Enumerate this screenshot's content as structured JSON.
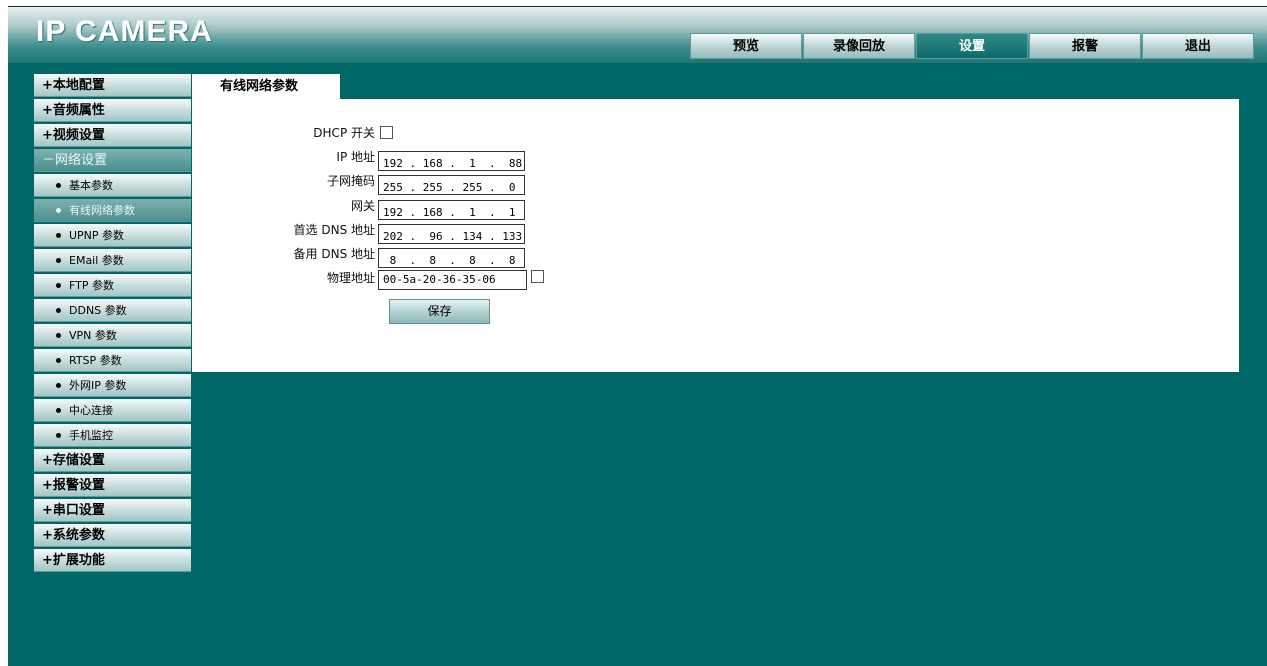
{
  "header": {
    "title": "IP CAMERA"
  },
  "topnav": {
    "tabs": [
      {
        "label": "预览",
        "active": false
      },
      {
        "label": "录像回放",
        "active": false
      },
      {
        "label": "设置",
        "active": true
      },
      {
        "label": "报警",
        "active": false
      },
      {
        "label": "退出",
        "active": false
      }
    ]
  },
  "sidebar": {
    "items": [
      {
        "label": "+本地配置",
        "kind": "cat"
      },
      {
        "label": "+音频属性",
        "kind": "cat"
      },
      {
        "label": "+视频设置",
        "kind": "cat"
      },
      {
        "label": "－网络设置",
        "kind": "cat-open"
      },
      {
        "label": "基本参数",
        "kind": "sub"
      },
      {
        "label": "有线网络参数",
        "kind": "sub-active"
      },
      {
        "label": "UPNP 参数",
        "kind": "sub"
      },
      {
        "label": "EMail 参数",
        "kind": "sub"
      },
      {
        "label": "FTP 参数",
        "kind": "sub"
      },
      {
        "label": "DDNS 参数",
        "kind": "sub"
      },
      {
        "label": "VPN 参数",
        "kind": "sub"
      },
      {
        "label": "RTSP 参数",
        "kind": "sub"
      },
      {
        "label": "外网IP 参数",
        "kind": "sub"
      },
      {
        "label": "中心连接",
        "kind": "sub"
      },
      {
        "label": "手机监控",
        "kind": "sub"
      },
      {
        "label": "+存储设置",
        "kind": "cat"
      },
      {
        "label": "+报警设置",
        "kind": "cat"
      },
      {
        "label": "+串口设置",
        "kind": "cat"
      },
      {
        "label": "+系统参数",
        "kind": "cat"
      },
      {
        "label": "+扩展功能",
        "kind": "cat"
      }
    ]
  },
  "content": {
    "tab_title": "有线网络参数",
    "form": {
      "dhcp_label": "DHCP 开关",
      "dhcp_checked": false,
      "ip_label": "IP 地址",
      "ip_value": "192 . 168 .  1  .  88",
      "mask_label": "子网掩码",
      "mask_value": "255 . 255 . 255 .  0",
      "gateway_label": "网关",
      "gateway_value": "192 . 168 .  1  .  1",
      "dns1_label": "首选 DNS 地址",
      "dns1_value": "202 .  96 . 134 . 133",
      "dns2_label": "备用 DNS 地址",
      "dns2_value": " 8  .  8  .  8  .  8",
      "mac_label": "物理地址",
      "mac_value": "00-5a-20-36-35-06",
      "mac_checked": false,
      "save_label": "保存"
    }
  }
}
